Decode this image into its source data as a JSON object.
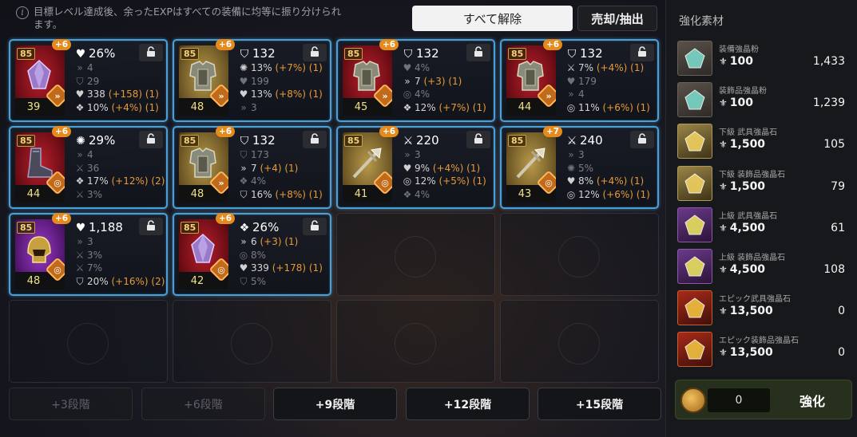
{
  "header": {
    "info_text": "目標レベル達成後、余ったEXPはすべての装備に均等に振り分けられます。",
    "release_all_label": "すべて解除",
    "sell_extract_label": "売却/抽出"
  },
  "items": [
    {
      "level": "85",
      "plus": "+6",
      "count": "39",
      "color": "red",
      "art": "crystal",
      "badge": "»",
      "main_icon": "♥",
      "main": "26%",
      "subs": [
        {
          "icon": "»",
          "text": "4",
          "bonus": "",
          "dim": true
        },
        {
          "icon": "⛉",
          "text": "29",
          "bonus": "",
          "dim": true
        },
        {
          "icon": "♥",
          "text": "338",
          "bonus": "(+158) (1)",
          "dim": false
        },
        {
          "icon": "❖",
          "text": "10%",
          "bonus": "(+4%) (1)",
          "dim": false
        }
      ]
    },
    {
      "level": "85",
      "plus": "+6",
      "count": "48",
      "color": "gold",
      "art": "armor",
      "badge": "»",
      "main_icon": "⛉",
      "main": "132",
      "subs": [
        {
          "icon": "✺",
          "text": "13%",
          "bonus": "(+7%) (1)",
          "dim": false
        },
        {
          "icon": "♥",
          "text": "199",
          "bonus": "",
          "dim": true
        },
        {
          "icon": "♥",
          "text": "13%",
          "bonus": "(+8%) (1)",
          "dim": false
        },
        {
          "icon": "»",
          "text": "3",
          "bonus": "",
          "dim": true
        }
      ]
    },
    {
      "level": "85",
      "plus": "+6",
      "count": "45",
      "color": "red",
      "art": "armor",
      "badge": "»",
      "main_icon": "⛉",
      "main": "132",
      "subs": [
        {
          "icon": "♥",
          "text": "4%",
          "bonus": "",
          "dim": true
        },
        {
          "icon": "»",
          "text": "7",
          "bonus": "(+3) (1)",
          "dim": false
        },
        {
          "icon": "◎",
          "text": "4%",
          "bonus": "",
          "dim": true
        },
        {
          "icon": "❖",
          "text": "12%",
          "bonus": "(+7%) (1)",
          "dim": false
        }
      ]
    },
    {
      "level": "85",
      "plus": "+6",
      "count": "44",
      "color": "red",
      "art": "armor",
      "badge": "»",
      "main_icon": "⛉",
      "main": "132",
      "subs": [
        {
          "icon": "⚔",
          "text": "7%",
          "bonus": "(+4%) (1)",
          "dim": false
        },
        {
          "icon": "♥",
          "text": "179",
          "bonus": "",
          "dim": true
        },
        {
          "icon": "»",
          "text": "4",
          "bonus": "",
          "dim": true
        },
        {
          "icon": "◎",
          "text": "11%",
          "bonus": "(+6%) (1)",
          "dim": false
        }
      ]
    },
    {
      "level": "85",
      "plus": "+6",
      "count": "44",
      "color": "red",
      "art": "boots",
      "badge": "◎",
      "main_icon": "✺",
      "main": "29%",
      "subs": [
        {
          "icon": "»",
          "text": "4",
          "bonus": "",
          "dim": true
        },
        {
          "icon": "⚔",
          "text": "36",
          "bonus": "",
          "dim": true
        },
        {
          "icon": "❖",
          "text": "17%",
          "bonus": "(+12%) (2)",
          "dim": false
        },
        {
          "icon": "⚔",
          "text": "3%",
          "bonus": "",
          "dim": true
        }
      ]
    },
    {
      "level": "85",
      "plus": "+6",
      "count": "48",
      "color": "gold",
      "art": "armor",
      "badge": "»",
      "main_icon": "⛉",
      "main": "132",
      "subs": [
        {
          "icon": "⛉",
          "text": "173",
          "bonus": "",
          "dim": true
        },
        {
          "icon": "»",
          "text": "7",
          "bonus": "(+4) (1)",
          "dim": false
        },
        {
          "icon": "❖",
          "text": "4%",
          "bonus": "",
          "dim": true
        },
        {
          "icon": "⛉",
          "text": "16%",
          "bonus": "(+8%) (1)",
          "dim": false
        }
      ]
    },
    {
      "level": "85",
      "plus": "+6",
      "count": "41",
      "color": "gold",
      "art": "weapon",
      "badge": "◎",
      "main_icon": "⚔",
      "main": "220",
      "subs": [
        {
          "icon": "»",
          "text": "3",
          "bonus": "",
          "dim": true
        },
        {
          "icon": "♥",
          "text": "9%",
          "bonus": "(+4%) (1)",
          "dim": false
        },
        {
          "icon": "◎",
          "text": "12%",
          "bonus": "(+5%) (1)",
          "dim": false
        },
        {
          "icon": "❖",
          "text": "4%",
          "bonus": "",
          "dim": true
        }
      ]
    },
    {
      "level": "85",
      "plus": "+7",
      "count": "43",
      "color": "gold",
      "art": "weapon",
      "badge": "◎",
      "main_icon": "⚔",
      "main": "240",
      "subs": [
        {
          "icon": "»",
          "text": "3",
          "bonus": "",
          "dim": true
        },
        {
          "icon": "✺",
          "text": "5%",
          "bonus": "",
          "dim": true
        },
        {
          "icon": "♥",
          "text": "8%",
          "bonus": "(+4%) (1)",
          "dim": false
        },
        {
          "icon": "◎",
          "text": "12%",
          "bonus": "(+6%) (1)",
          "dim": false
        }
      ]
    },
    {
      "level": "85",
      "plus": "+6",
      "count": "48",
      "color": "purple",
      "art": "helmet",
      "badge": "◎",
      "main_icon": "♥",
      "main": "1,188",
      "subs": [
        {
          "icon": "»",
          "text": "3",
          "bonus": "",
          "dim": true
        },
        {
          "icon": "⚔",
          "text": "3%",
          "bonus": "",
          "dim": true
        },
        {
          "icon": "⚔",
          "text": "7%",
          "bonus": "",
          "dim": true
        },
        {
          "icon": "⛉",
          "text": "20%",
          "bonus": "(+16%) (2)",
          "dim": false
        }
      ]
    },
    {
      "level": "85",
      "plus": "+6",
      "count": "42",
      "color": "red",
      "art": "crystal",
      "badge": "◎",
      "main_icon": "❖",
      "main": "26%",
      "subs": [
        {
          "icon": "»",
          "text": "6",
          "bonus": "(+3) (1)",
          "dim": false
        },
        {
          "icon": "◎",
          "text": "8%",
          "bonus": "",
          "dim": true
        },
        {
          "icon": "♥",
          "text": "339",
          "bonus": "(+178) (1)",
          "dim": false
        },
        {
          "icon": "⛉",
          "text": "5%",
          "bonus": "",
          "dim": true
        }
      ]
    }
  ],
  "tiers": [
    {
      "label": "+3段階",
      "enabled": false
    },
    {
      "label": "+6段階",
      "enabled": false
    },
    {
      "label": "+9段階",
      "enabled": true
    },
    {
      "label": "+12段階",
      "enabled": true
    },
    {
      "label": "+15段階",
      "enabled": true
    }
  ],
  "panel": {
    "title": "強化素材",
    "materials": [
      {
        "name": "装備強晶粉",
        "cost": "100",
        "qty": "1,433",
        "tier": "grey"
      },
      {
        "name": "装飾品強晶粉",
        "cost": "100",
        "qty": "1,239",
        "tier": "grey"
      },
      {
        "name": "下級 武具強晶石",
        "cost": "1,500",
        "qty": "105",
        "tier": "gold"
      },
      {
        "name": "下級 装飾品強晶石",
        "cost": "1,500",
        "qty": "79",
        "tier": "gold"
      },
      {
        "name": "上級 武具強晶石",
        "cost": "4,500",
        "qty": "61",
        "tier": "purple"
      },
      {
        "name": "上級 装飾品強晶石",
        "cost": "4,500",
        "qty": "108",
        "tier": "purple"
      },
      {
        "name": "エピック武具強晶石",
        "cost": "13,500",
        "qty": "0",
        "tier": "red"
      },
      {
        "name": "エピック装飾品強晶石",
        "cost": "13,500",
        "qty": "0",
        "tier": "red"
      }
    ],
    "coin_value": "0",
    "enhance_label": "強化"
  }
}
